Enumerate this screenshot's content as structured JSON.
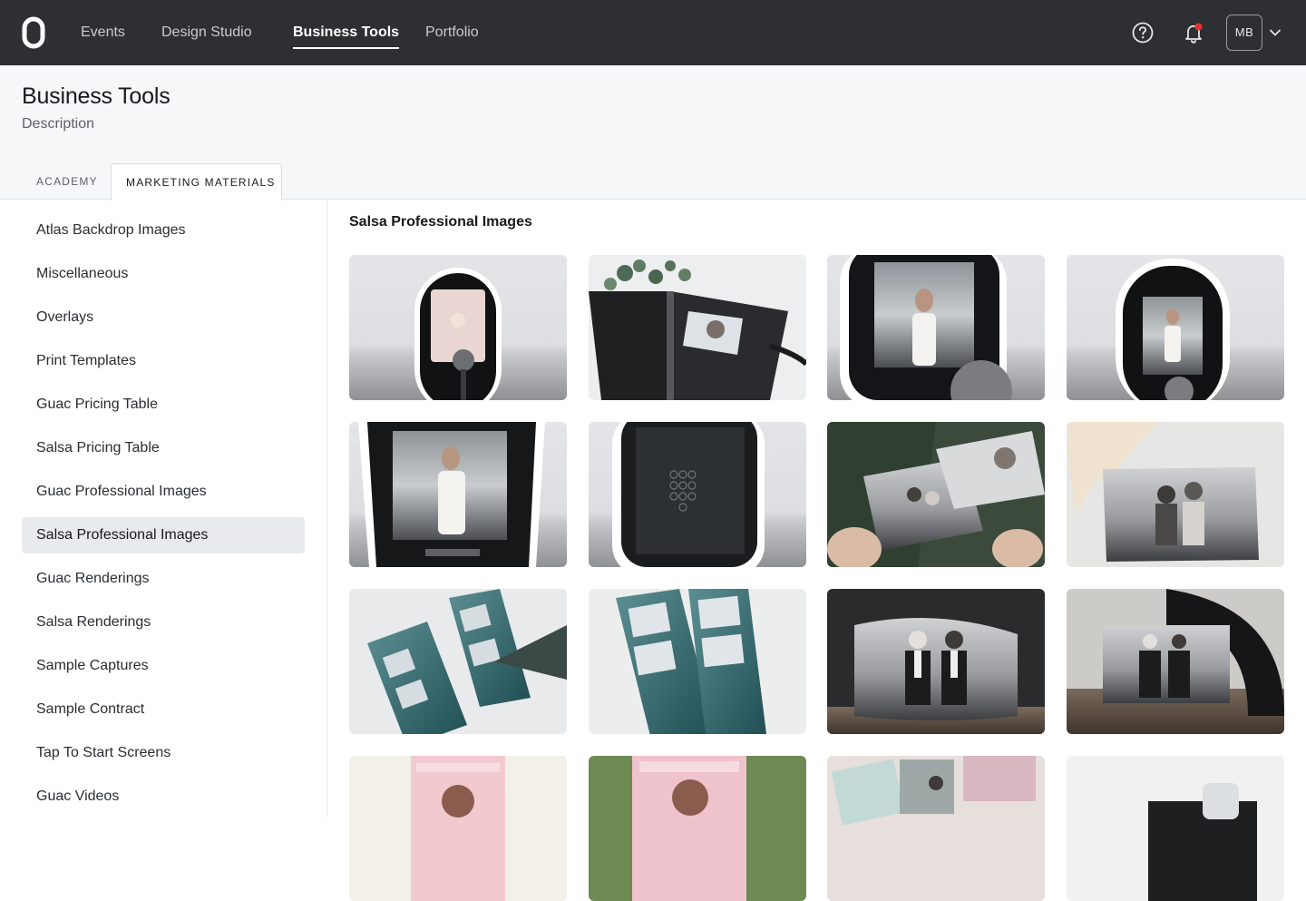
{
  "nav": {
    "links": [
      {
        "label": "Events"
      },
      {
        "label": "Design Studio"
      },
      {
        "label": "Business Tools"
      },
      {
        "label": "Portfolio"
      }
    ],
    "active": "Business Tools",
    "avatar_initials": "MB",
    "notification_dot_color": "#e5322b"
  },
  "header": {
    "title": "Business Tools",
    "description": "Description",
    "tabs": [
      {
        "label": "ACADEMY"
      },
      {
        "label": "MARKETING MATERIALS"
      }
    ],
    "active_tab": "MARKETING MATERIALS"
  },
  "sidebar": {
    "items": [
      {
        "label": "Atlas Backdrop Images"
      },
      {
        "label": "Miscellaneous"
      },
      {
        "label": "Overlays"
      },
      {
        "label": "Print Templates"
      },
      {
        "label": "Guac Pricing Table"
      },
      {
        "label": "Salsa Pricing Table"
      },
      {
        "label": "Guac Professional Images"
      },
      {
        "label": "Salsa Professional Images"
      },
      {
        "label": "Guac Renderings"
      },
      {
        "label": "Salsa Renderings"
      },
      {
        "label": "Sample Captures"
      },
      {
        "label": "Sample Contract"
      },
      {
        "label": "Tap To Start Screens"
      },
      {
        "label": "Guac Videos"
      }
    ],
    "active": "Salsa Professional Images"
  },
  "content": {
    "section_title": "Salsa Professional Images",
    "images": [
      {
        "subject": "booth-front-attract-screen"
      },
      {
        "subject": "guest-book-with-eucalyptus"
      },
      {
        "subject": "booth-screen-woman-live-view"
      },
      {
        "subject": "booth-front-woman-live-view"
      },
      {
        "subject": "booth-angled-woman-live-view"
      },
      {
        "subject": "booth-keypad-screen"
      },
      {
        "subject": "hands-holding-print"
      },
      {
        "subject": "print-with-dried-palm"
      },
      {
        "subject": "photo-strips-teal"
      },
      {
        "subject": "photo-strips-teal-closeup"
      },
      {
        "subject": "bw-print-couple-curled"
      },
      {
        "subject": "bw-print-couple-table"
      },
      {
        "subject": "pink-strip-pineapple"
      },
      {
        "subject": "pink-strip-plant"
      },
      {
        "subject": "prints-collage"
      },
      {
        "subject": "black-guest-book"
      }
    ]
  }
}
